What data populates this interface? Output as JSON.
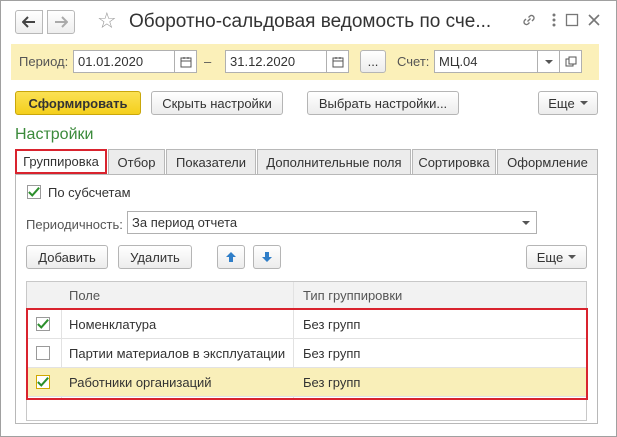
{
  "window": {
    "title": "Оборотно-сальдовая ведомость по сче...",
    "nav_back_icon": "arrow-left-icon",
    "nav_forward_icon": "arrow-right-icon",
    "favorite_icon": "star-icon"
  },
  "period": {
    "label": "Период:",
    "from": "01.01.2020",
    "dash": "–",
    "to": "31.12.2020",
    "more_btn": "...",
    "account_label": "Счет:",
    "account_value": "МЦ.04"
  },
  "toolbar": {
    "generate_label": "Сформировать",
    "hide_settings_label": "Скрыть настройки",
    "choose_settings_label": "Выбрать настройки...",
    "more_label": "Еще"
  },
  "settings": {
    "title": "Настройки",
    "tabs": [
      {
        "label": "Группировка",
        "active": true
      },
      {
        "label": "Отбор"
      },
      {
        "label": "Показатели"
      },
      {
        "label": "Дополнительные поля"
      },
      {
        "label": "Сортировка"
      },
      {
        "label": "Оформление"
      }
    ],
    "by_subaccounts_label": "По субсчетам",
    "by_subaccounts_checked": true,
    "periodicity_label": "Периодичность:",
    "periodicity_value": "За период отчета",
    "add_label": "Добавить",
    "delete_label": "Удалить",
    "more_label": "Еще",
    "table": {
      "columns": [
        "Поле",
        "Тип группировки"
      ],
      "rows": [
        {
          "checked": true,
          "field": "Номенклатура",
          "type": "Без групп"
        },
        {
          "checked": false,
          "field": "Партии материалов в эксплуатации",
          "type": "Без групп"
        },
        {
          "checked": true,
          "field": "Работники организаций",
          "type": "Без групп",
          "selected": true
        }
      ]
    }
  },
  "colors": {
    "accent_yellow": "#f4cf1c",
    "panel_yellow": "#fbf0b9",
    "section_green": "#3b8a3b",
    "highlight_red": "#d9232e",
    "check_green": "#2c8f2c"
  }
}
